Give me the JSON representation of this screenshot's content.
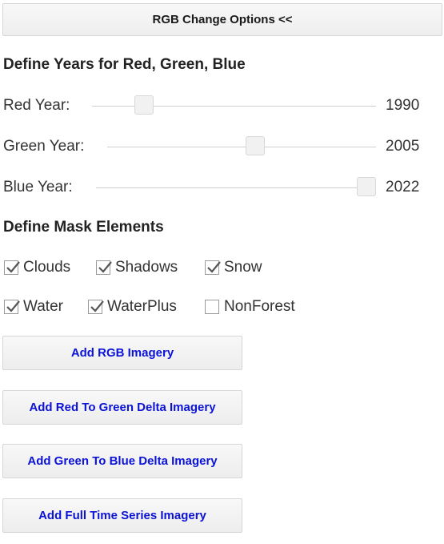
{
  "toggle_button": {
    "label": "RGB Change Options <<"
  },
  "years_section": {
    "heading": "Define Years for Red, Green, Blue",
    "sliders": [
      {
        "label": "Red Year:",
        "value": "1990",
        "position": 0.19
      },
      {
        "label": "Green Year:",
        "value": "2005",
        "position": 0.55
      },
      {
        "label": "Blue Year:",
        "value": "2022",
        "position": 1.0
      }
    ]
  },
  "mask_section": {
    "heading": "Define Mask Elements",
    "checkboxes": [
      {
        "label": "Clouds",
        "checked": true
      },
      {
        "label": "Shadows",
        "checked": true
      },
      {
        "label": "Snow",
        "checked": true
      },
      {
        "label": "Water",
        "checked": true
      },
      {
        "label": "WaterPlus",
        "checked": true
      },
      {
        "label": "NonForest",
        "checked": false
      }
    ]
  },
  "actions": [
    {
      "label": "Add RGB Imagery"
    },
    {
      "label": "Add Red To Green Delta Imagery"
    },
    {
      "label": "Add Green To Blue Delta Imagery"
    },
    {
      "label": "Add Full Time Series Imagery"
    }
  ],
  "colors": {
    "accent_text": "#0b13d6",
    "button_bg": "#f1f1f1",
    "border": "#d6d6d6"
  }
}
